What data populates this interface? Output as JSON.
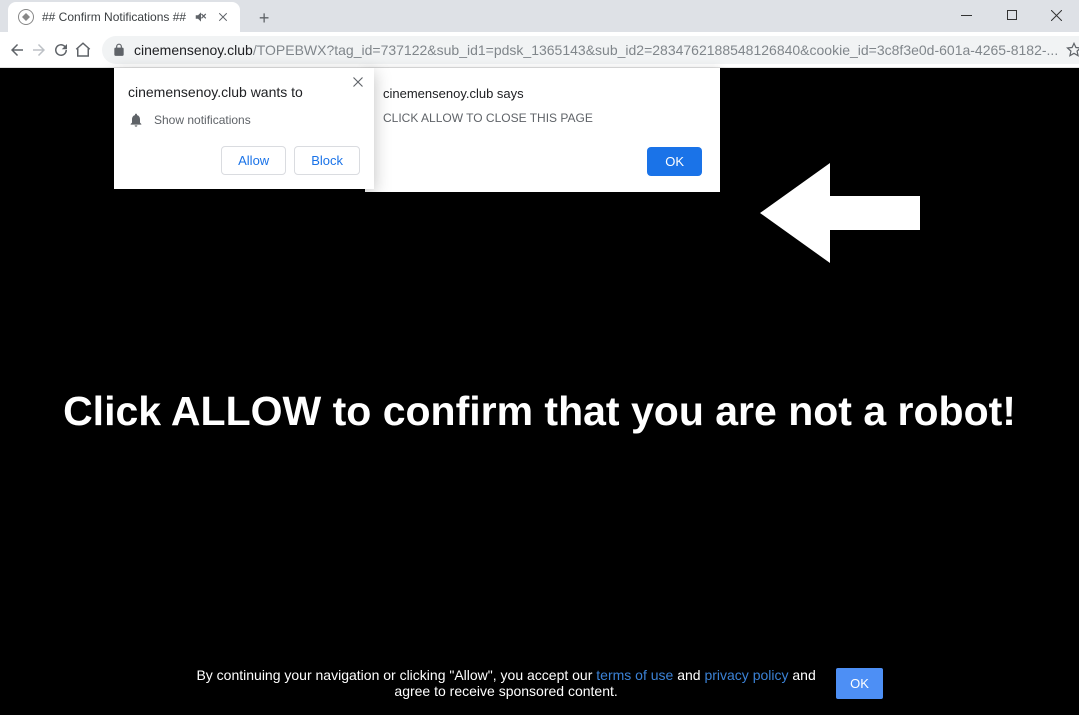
{
  "tab": {
    "title": "## Confirm Notifications ##"
  },
  "url": {
    "domain": "cinemensenoy.club",
    "path": "/TOPEBWX?tag_id=737122&sub_id1=pdsk_1365143&sub_id2=2834762188548126840&cookie_id=3c8f3e0d-601a-4265-8182-..."
  },
  "page": {
    "main_text": "Click ALLOW to confirm that you are not a robot!",
    "footer_pre": "By continuing your navigation or clicking \"Allow\", you accept our ",
    "terms_link": "terms of use",
    "and": " and ",
    "privacy_link": "privacy policy",
    "footer_post": " and agree to receive sponsored content.",
    "footer_ok": "OK"
  },
  "js_alert": {
    "title": "cinemensenoy.club says",
    "message": "CLICK ALLOW TO CLOSE THIS PAGE",
    "ok": "OK"
  },
  "notif": {
    "title": "cinemensenoy.club wants to",
    "row": "Show notifications",
    "allow": "Allow",
    "block": "Block"
  }
}
